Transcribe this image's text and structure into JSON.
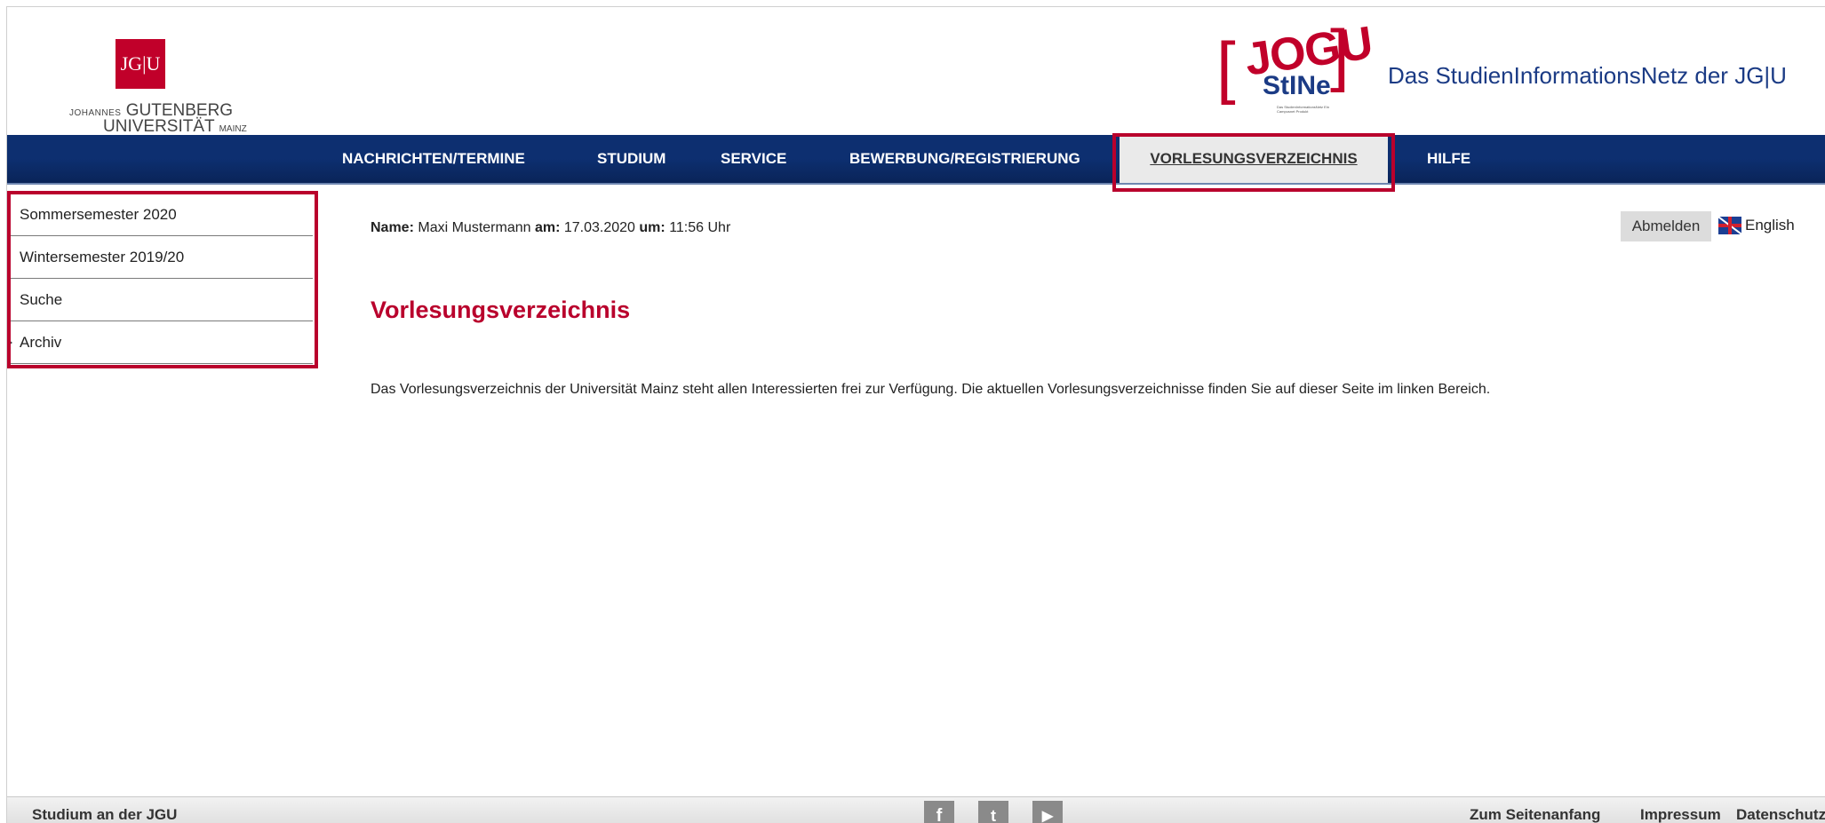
{
  "header": {
    "jgu_logo_mark": "JG|U",
    "jgu_logo_line1_small": "JOHANNES",
    "jgu_logo_line1": "GUTENBERG",
    "jgu_logo_line2": "UNIVERSITÄT",
    "jgu_logo_line2_small": "MAINZ",
    "stine_logo_top": "JOGU",
    "stine_logo_bottom": "StINe",
    "stine_logo_fine": "Das StudienInformationsNetz Ein Campusnet Produkt",
    "site_title": "Das StudienInformationsNetz der JG|U"
  },
  "nav": {
    "items": [
      {
        "label": "NACHRICHTEN/TERMINE"
      },
      {
        "label": "STUDIUM"
      },
      {
        "label": "SERVICE"
      },
      {
        "label": "BEWERBUNG/REGISTRIERUNG"
      },
      {
        "label": "VORLESUNGSVERZEICHNIS",
        "active": true
      },
      {
        "label": "HILFE"
      }
    ]
  },
  "sidebar": {
    "items": [
      {
        "label": "Sommersemester 2020"
      },
      {
        "label": "Wintersemester 2019/20"
      },
      {
        "label": "Suche"
      },
      {
        "label": "Archiv"
      }
    ]
  },
  "userinfo": {
    "name_label": "Name:",
    "name_value": "Maxi Mustermann",
    "date_label": "am:",
    "date_value": "17.03.2020",
    "time_label": "um:",
    "time_value": "11:56 Uhr"
  },
  "actions": {
    "logout_label": "Abmelden",
    "language_label": "English"
  },
  "content": {
    "title": "Vorlesungsverzeichnis",
    "intro": "Das Vorlesungsverzeichnis der Universität Mainz steht allen Interessierten frei zur Verfügung. Die aktuellen Vorlesungsverzeichnisse finden Sie auf dieser Seite im linken Bereich."
  },
  "footer": {
    "left_label": "Studium an der JGU",
    "social": {
      "facebook": "f",
      "twitter": "t",
      "youtube": "▶"
    },
    "links": [
      {
        "label": "Zum Seitenanfang"
      },
      {
        "label": "Impressum"
      },
      {
        "label": "Datenschutz"
      }
    ]
  },
  "colors": {
    "accent_red": "#b9002c",
    "nav_blue": "#0d2f70",
    "title_blue": "#1b3b85"
  }
}
